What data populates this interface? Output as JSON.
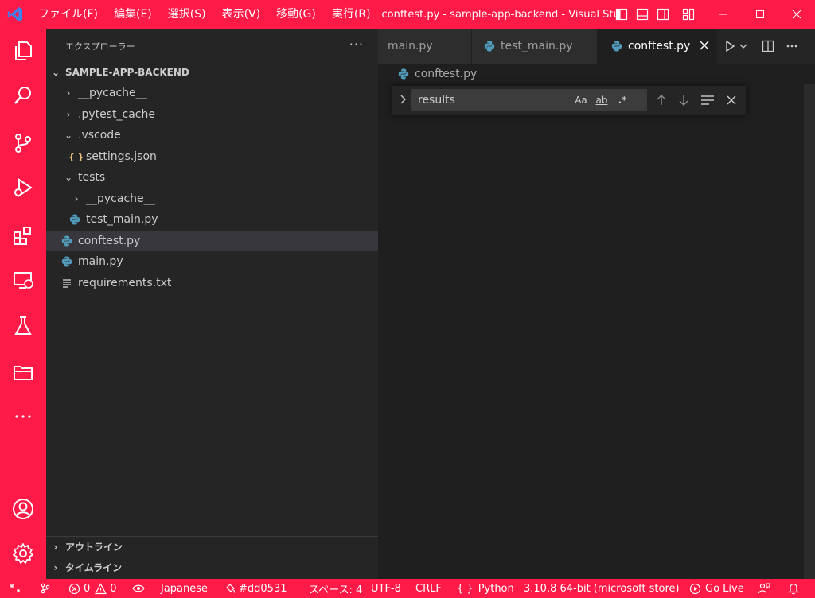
{
  "titlebar": {
    "menus": [
      "ファイル(F)",
      "編集(E)",
      "選択(S)",
      "表示(V)",
      "移動(G)",
      "実行(R)"
    ],
    "title": "conftest.py - sample-app-backend - Visual Studio Code"
  },
  "sidebar": {
    "header": "エクスプローラー",
    "more": "···",
    "project": "SAMPLE-APP-BACKEND",
    "tree": [
      {
        "label": "__pycache__",
        "type": "folder",
        "expanded": false
      },
      {
        "label": ".pytest_cache",
        "type": "folder",
        "expanded": false
      },
      {
        "label": ".vscode",
        "type": "folder",
        "expanded": true
      },
      {
        "label": "settings.json",
        "type": "json"
      },
      {
        "label": "tests",
        "type": "folder",
        "expanded": true
      },
      {
        "label": "__pycache__",
        "type": "folder",
        "expanded": false
      },
      {
        "label": "test_main.py",
        "type": "python"
      },
      {
        "label": "conftest.py",
        "type": "python",
        "selected": true
      },
      {
        "label": "main.py",
        "type": "python"
      },
      {
        "label": "requirements.txt",
        "type": "text"
      }
    ],
    "outline": "アウトライン",
    "timeline": "タイムライン"
  },
  "editor": {
    "tabs": [
      {
        "label": "main.py",
        "active": false
      },
      {
        "label": "test_main.py",
        "active": false
      },
      {
        "label": "conftest.py",
        "active": true
      }
    ],
    "breadcrumb": "conftest.py",
    "find": {
      "value": "results",
      "match_case": "Aa",
      "whole_word": "ab",
      "regex": ".*"
    }
  },
  "statusbar": {
    "errors": "0",
    "warnings": "0",
    "language_ime": "Japanese",
    "color": "#dd0531",
    "spaces": "スペース: 4",
    "encoding": "UTF-8",
    "eol": "CRLF",
    "language": "Python",
    "interpreter": "3.10.8 64-bit (microsoft store)",
    "golive": "Go Live"
  },
  "colors": {
    "accent": "#ff1a47",
    "sidebar_bg": "#252526",
    "editor_bg": "#1f1f1f",
    "python_blue": "#519aba"
  }
}
